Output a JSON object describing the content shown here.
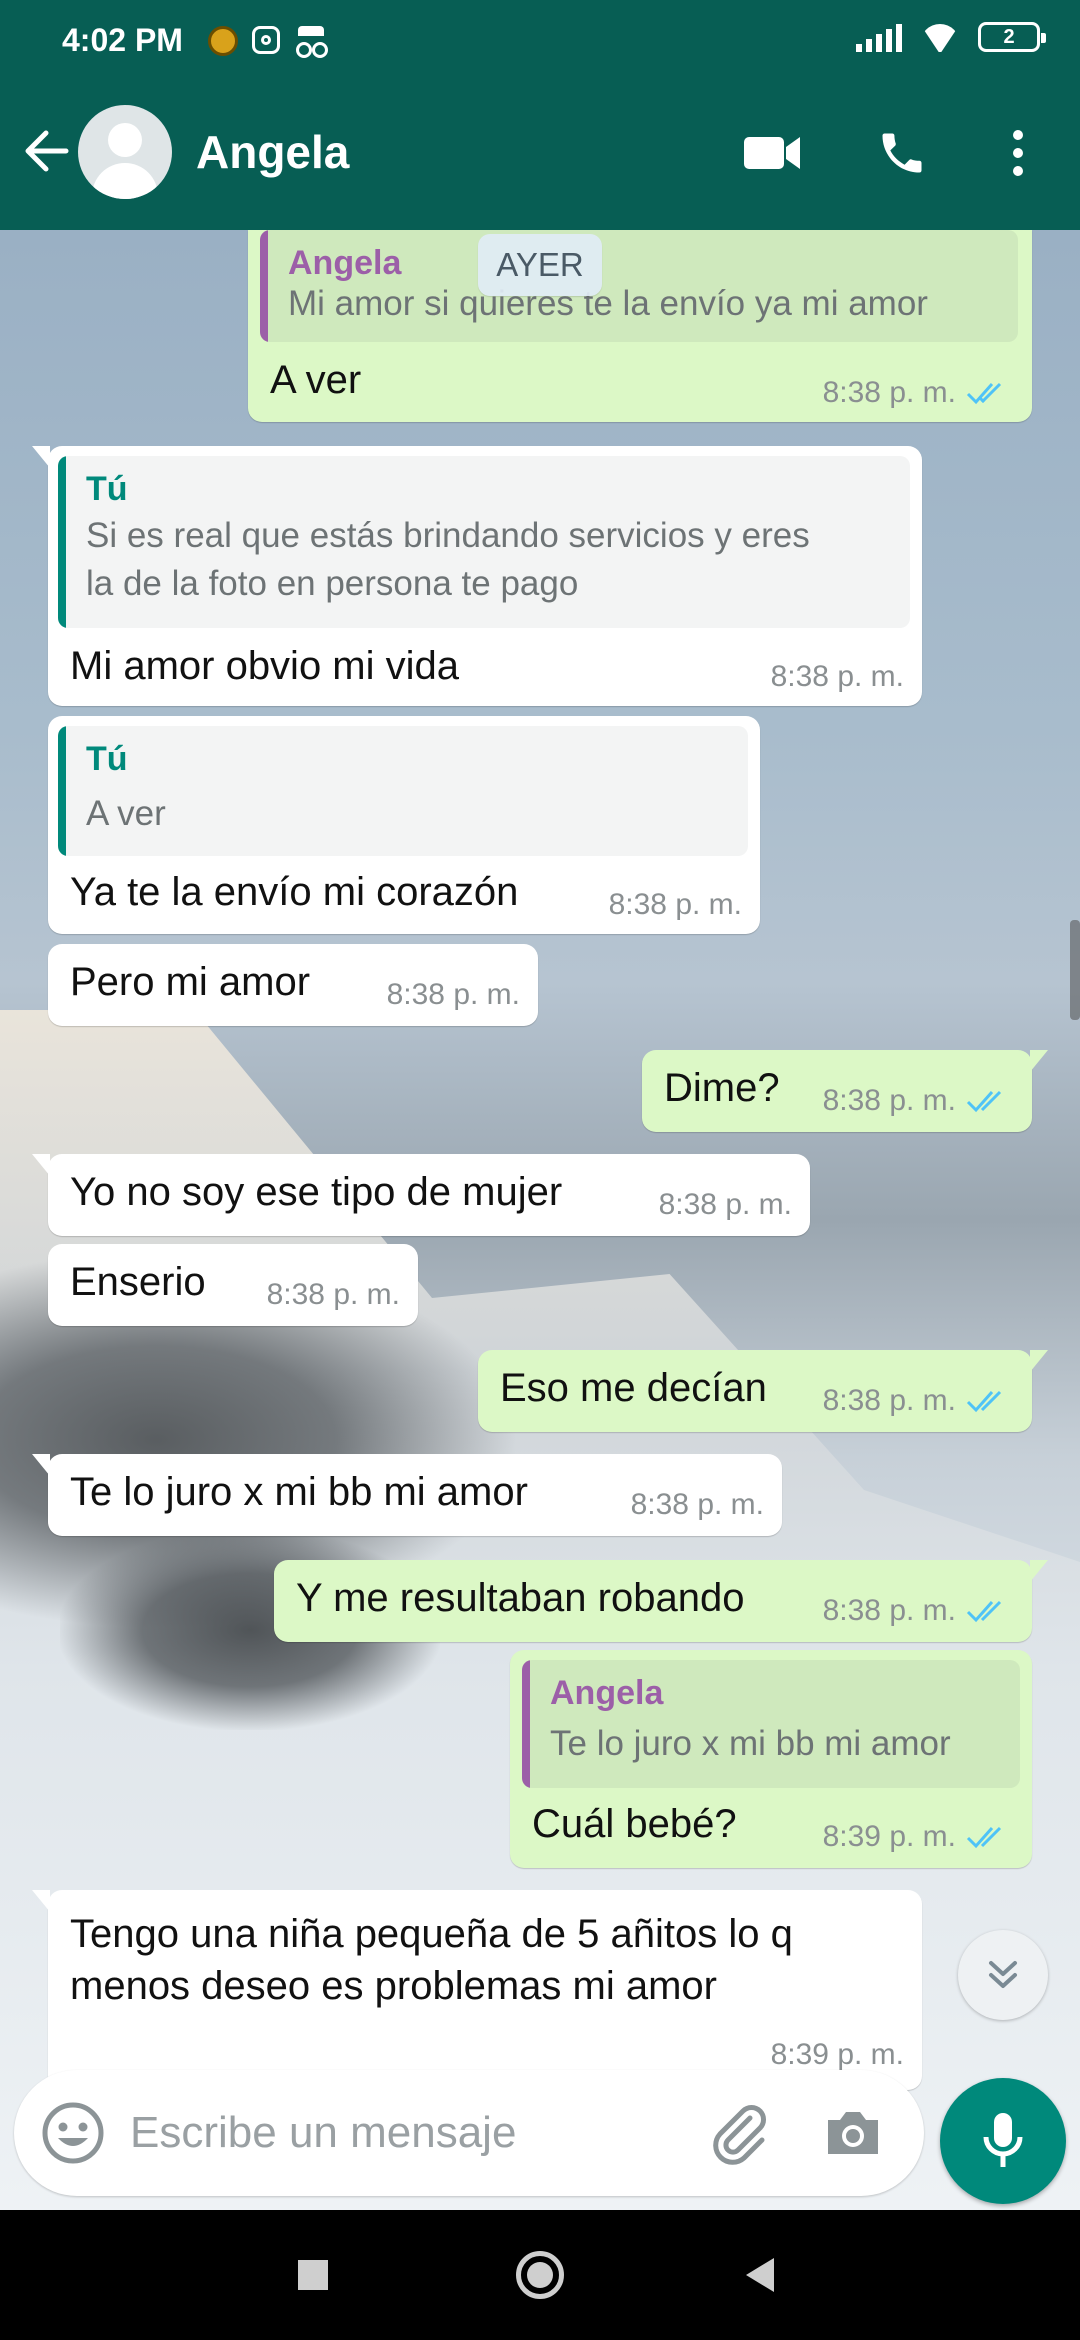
{
  "status_bar": {
    "time": "4:02 PM",
    "battery": "2",
    "icons": [
      "coin-icon",
      "instagram-icon",
      "incognito-icon",
      "signal-icon",
      "wifi-icon",
      "battery-icon"
    ]
  },
  "header": {
    "contact_name": "Angela",
    "icons": [
      "back-arrow-icon",
      "avatar",
      "video-call-icon",
      "phone-icon",
      "more-vert-icon"
    ]
  },
  "colors": {
    "header": "#075e54",
    "outgoing_bubble": "#dcf8c6",
    "incoming_bubble": "#ffffff",
    "accent": "#00897b",
    "read_ticks": "#4fc3f7",
    "quote_in_name": "#00897b",
    "quote_out_name": "#9c5fa8"
  },
  "day_separator": "AYER",
  "messages": [
    {
      "dir": "out",
      "quote_name": "Angela",
      "quote_text": "Mi amor si quieres te la envío ya mi amor",
      "text": "A ver",
      "time": "8:38 p. m.",
      "read": true
    },
    {
      "dir": "in",
      "quote_name": "Tú",
      "quote_text": [
        "Si es real que estás brindando servicios y eres",
        "la de la foto en persona te pago"
      ],
      "text": "Mi amor obvio mi vida",
      "time": "8:38 p. m."
    },
    {
      "dir": "in",
      "quote_name": "Tú",
      "quote_text": "A ver",
      "text": "Ya te la envío mi corazón",
      "time": "8:38 p. m."
    },
    {
      "dir": "in",
      "text": "Pero mi amor",
      "time": "8:38 p. m."
    },
    {
      "dir": "out",
      "text": "Dime?",
      "time": "8:38 p. m.",
      "read": true
    },
    {
      "dir": "in",
      "text": "Yo no soy ese tipo de mujer",
      "time": "8:38 p. m."
    },
    {
      "dir": "in",
      "text": "Enserio",
      "time": "8:38 p. m."
    },
    {
      "dir": "out",
      "text": "Eso me decían",
      "time": "8:38 p. m.",
      "read": true
    },
    {
      "dir": "in",
      "text": "Te lo juro x mi bb mi amor",
      "time": "8:38 p. m."
    },
    {
      "dir": "out",
      "text": "Y me resultaban robando",
      "time": "8:38 p. m.",
      "read": true
    },
    {
      "dir": "out",
      "quote_name": "Angela",
      "quote_text": "Te lo juro x mi bb mi amor",
      "text": "Cuál bebé?",
      "time": "8:39 p. m.",
      "read": true
    },
    {
      "dir": "in",
      "text": [
        "Tengo una niña pequeña de 5 añitos lo q",
        "menos deseo es problemas mi amor"
      ],
      "time": "8:39 p. m."
    }
  ],
  "composer": {
    "placeholder": "Escribe un mensaje",
    "icons": [
      "emoji-icon",
      "attach-icon",
      "camera-icon",
      "mic-icon"
    ]
  },
  "nav_bar": {
    "icons": [
      "recents-icon",
      "home-icon",
      "back-icon"
    ]
  }
}
